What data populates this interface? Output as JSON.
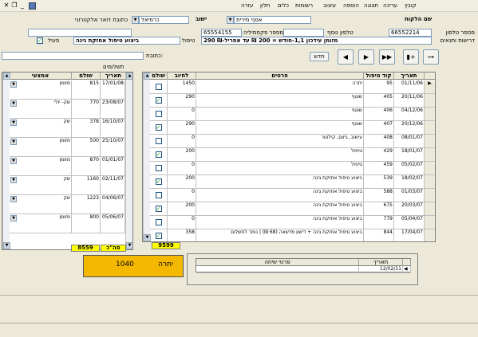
{
  "menu": {
    "items": [
      "קובץ",
      "עריכה",
      "תצוגה",
      "הוספה",
      "עיצוב",
      "רשומות",
      "כלים",
      "חלון",
      "עזרה"
    ]
  },
  "form": {
    "customer_name_label": "שם הלקוח",
    "customer_name_value": "אסף מירית",
    "city_label": "ישוב",
    "city_value": "כרמיאל",
    "email_label": "כתובת דואר אלקטרוני",
    "email_value": "",
    "phone_label": "מספר טלפון",
    "phone_value": "66552214",
    "extra_phone_label": "טלפון נוסף",
    "extra_phone_value": "",
    "fax_label": "מספר פקסמיליה",
    "fax_value": "65554155",
    "requirements_label": "דרישות ותנאים",
    "requirements_value": "290 ₪-מזומן עידכון 1,1-חודש = 200 ₪ עד אפריל",
    "treatment_label": "טיפול",
    "treatment_value": "ביצוע טיפול אחזקת גינה",
    "active_label": "פעיל",
    "active_checked": true,
    "address_label": "כתובת:",
    "address_value": ""
  },
  "toolbar": {
    "new_label": "חדש",
    "first_icon": "first-record-icon",
    "prev_icon": "prev-record-icon",
    "next_icon": "next-record-icon",
    "last_icon": "last-record-icon",
    "new_record_icon": "new-record-icon",
    "find_icon": "binoculars-icon"
  },
  "treatments": {
    "headers": {
      "date": "תאריך",
      "code": "קוד טיפול",
      "details": "פרטים",
      "charge": "לחיוב",
      "paid": "שולם"
    },
    "rows": [
      {
        "date": "01/11/06",
        "code": "95",
        "details": "יתרה",
        "charge": "1450",
        "paid": false,
        "current": true
      },
      {
        "date": "20/11/06",
        "code": "405",
        "details": "שוטף",
        "charge": "290",
        "paid": true,
        "current": false
      },
      {
        "date": "04/12/06",
        "code": "406",
        "details": "שוטף",
        "charge": "0",
        "paid": false,
        "current": false
      },
      {
        "date": "20/12/06",
        "code": "407",
        "details": "שוטף",
        "charge": "290",
        "paid": true,
        "current": false
      },
      {
        "date": "08/01/07",
        "code": "408",
        "details": "עישוב, גיזום, קילטור",
        "charge": "0",
        "paid": false,
        "current": false
      },
      {
        "date": "18/01/07",
        "code": "429",
        "details": "טיפול",
        "charge": "200",
        "paid": true,
        "current": false
      },
      {
        "date": "05/02/07",
        "code": "459",
        "details": "טיפול",
        "charge": "0",
        "paid": false,
        "current": false
      },
      {
        "date": "18/02/07",
        "code": "539",
        "details": "ביצוע טיפול אחזקת גינה",
        "charge": "200",
        "paid": true,
        "current": false
      },
      {
        "date": "01/03/07",
        "code": "588",
        "details": "ביצוע טיפול אחזקת גינה",
        "charge": "0",
        "paid": false,
        "current": false
      },
      {
        "date": "20/03/07",
        "code": "675",
        "details": "ביצוע טיפול אחזקת גינה",
        "charge": "200",
        "paid": true,
        "current": false
      },
      {
        "date": "05/04/07",
        "code": "779",
        "details": "ביצוע טיפול אחזקת גינה",
        "charge": "0",
        "paid": false,
        "current": false
      },
      {
        "date": "17/04/07",
        "code": "844",
        "details": "ביצוע טיפול אחזקת גינה + דישון מדשאה (68 ₪) | נותר לתשלום",
        "charge": "358",
        "paid": true,
        "current": false
      }
    ],
    "total": "9599"
  },
  "payments": {
    "title": "תשלומים",
    "headers": {
      "date": "תאריך",
      "amount": "שולם",
      "means": "אמצעי"
    },
    "rows": [
      {
        "date": "17/01/08",
        "amount": "815",
        "means": "מזומן"
      },
      {
        "date": "23/08/07",
        "amount": "770",
        "means": "שק- יולי"
      },
      {
        "date": "16/10/07",
        "amount": "378",
        "means": "שק"
      },
      {
        "date": "25/10/07",
        "amount": "500",
        "means": "מזומן"
      },
      {
        "date": "01/01/07",
        "amount": "870",
        "means": "מזומן"
      },
      {
        "date": "02/11/07",
        "amount": "1160",
        "means": "שק"
      },
      {
        "date": "04/06/07",
        "amount": "1223",
        "means": "שק"
      },
      {
        "date": "05/06/07",
        "amount": "800",
        "means": "מזומן"
      }
    ],
    "total_label": "סה\"כ",
    "total": "8559"
  },
  "balance": {
    "label": "יתרה",
    "value": "1040"
  },
  "calls": {
    "headers": {
      "date": "תאריך",
      "details": "פרטי שיחה"
    },
    "rows": [
      {
        "date": "12/02/11",
        "details": ""
      }
    ]
  },
  "colors": {
    "total_bg": "#ffff00",
    "balance_bg": "#f5b800",
    "check": "#21a121"
  }
}
